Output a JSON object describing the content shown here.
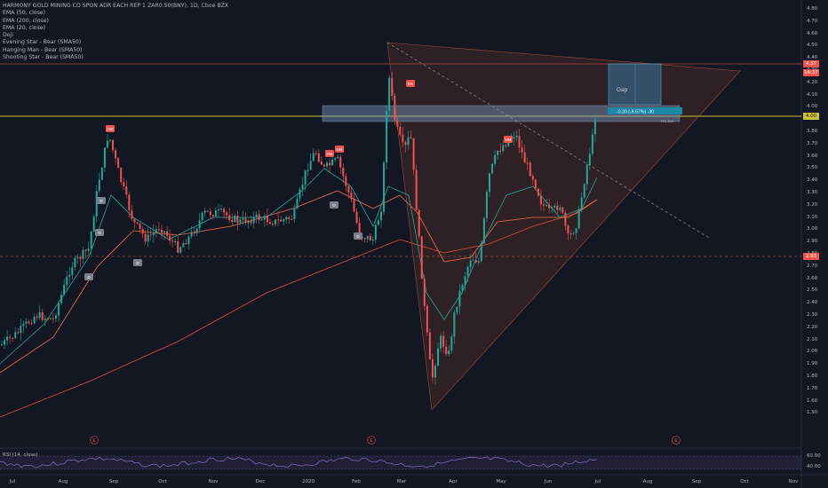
{
  "legend": {
    "title": "HARMONY GOLD MINING CO SPON ADR EACH REP 1 ZAR0.50(BNY), 1D, Cboe BZX",
    "items": [
      "EMA (50, close)",
      "EMA (200, close)",
      "EMA (20, close)",
      "Doji",
      "Evening Star - Bear (SMA50)",
      "Hanging Man - Bear (SMA50)",
      "Shooting Star - Bear (SMA50)"
    ]
  },
  "rsi_label": "RSI (14, close)",
  "y_axis": [
    "4.80",
    "4.70",
    "4.60",
    "4.50",
    "4.40",
    "4.30",
    "4.20",
    "4.10",
    "4.00",
    "3.90",
    "3.80",
    "3.70",
    "3.60",
    "3.50",
    "3.40",
    "3.30",
    "3.20",
    "3.10",
    "3.00",
    "2.90",
    "2.80",
    "2.70",
    "2.60",
    "2.50",
    "2.40",
    "2.30",
    "2.20",
    "2.10",
    "2.00",
    "1.90",
    "1.80",
    "1.70",
    "1.60",
    "1.50"
  ],
  "rsi_axis": [
    "60.00",
    "40.00"
  ],
  "x_axis": [
    "Jul",
    "Aug",
    "Sep",
    "Oct",
    "Nov",
    "Dec",
    "2020",
    "Feb",
    "Mar",
    "Apr",
    "May",
    "Jun",
    "Jul",
    "Aug",
    "Sep",
    "Oct",
    "Nov"
  ],
  "price_tags": {
    "last": "4.37",
    "second": "14:37",
    "level_4": "4.00",
    "level_low": "2.93"
  },
  "annotations": {
    "gap_label": "Gap",
    "measure_label": "-0.30 (-6.57%) -30",
    "bars_label": "No Bar"
  },
  "markers": {
    "doji": "D",
    "evening_star": "ES",
    "hanging_man": "HM",
    "shooting_star": "SS",
    "earnings": "E"
  },
  "colors": {
    "bg": "#131722",
    "up": "#26a69a",
    "down": "#ef5350",
    "ema20": "#26a69a",
    "ema50": "#ef6c4a",
    "ema200": "#e24c3a",
    "yellow": "#c9c43a",
    "rsi": "#7e57c2"
  }
}
